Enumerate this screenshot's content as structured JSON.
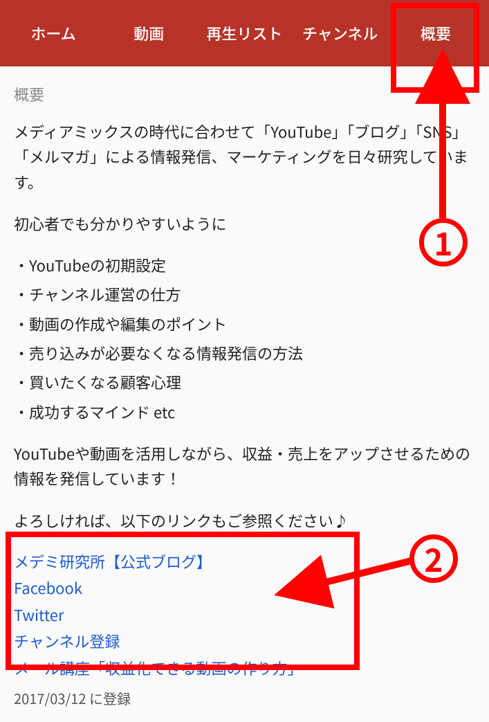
{
  "tabs": {
    "home": "ホーム",
    "videos": "動画",
    "playlists": "再生リスト",
    "channel": "チャンネル",
    "about": "概要"
  },
  "section_title": "概要",
  "about": {
    "intro": "メディアミックスの時代に合わせて「YouTube」「ブログ」「SNS」「メルマガ」による情報発信、マーケティングを日々研究しています。",
    "sub": "初心者でも分かりやすいように",
    "bullets": [
      "・YouTubeの初期設定",
      "・チャンネル運営の仕方",
      "・動画の作成や編集のポイント",
      "・売り込みが必要なくなる情報発信の方法",
      "・買いたくなる顧客心理",
      "・成功するマインド etc"
    ],
    "outro1": "YouTubeや動画を活用しながら、収益・売上をアップさせるための情報を発信しています！",
    "outro2": "よろしければ、以下のリンクもご参照ください♪"
  },
  "links": {
    "blog": "メデミ研究所【公式ブログ】",
    "facebook": "Facebook",
    "twitter": "Twitter",
    "subscribe": "チャンネル登録",
    "course": "メール講座「収益化できる動画の作り方」"
  },
  "registered": "2017/03/12 に登録",
  "annotations": {
    "one": "1",
    "two": "2"
  }
}
